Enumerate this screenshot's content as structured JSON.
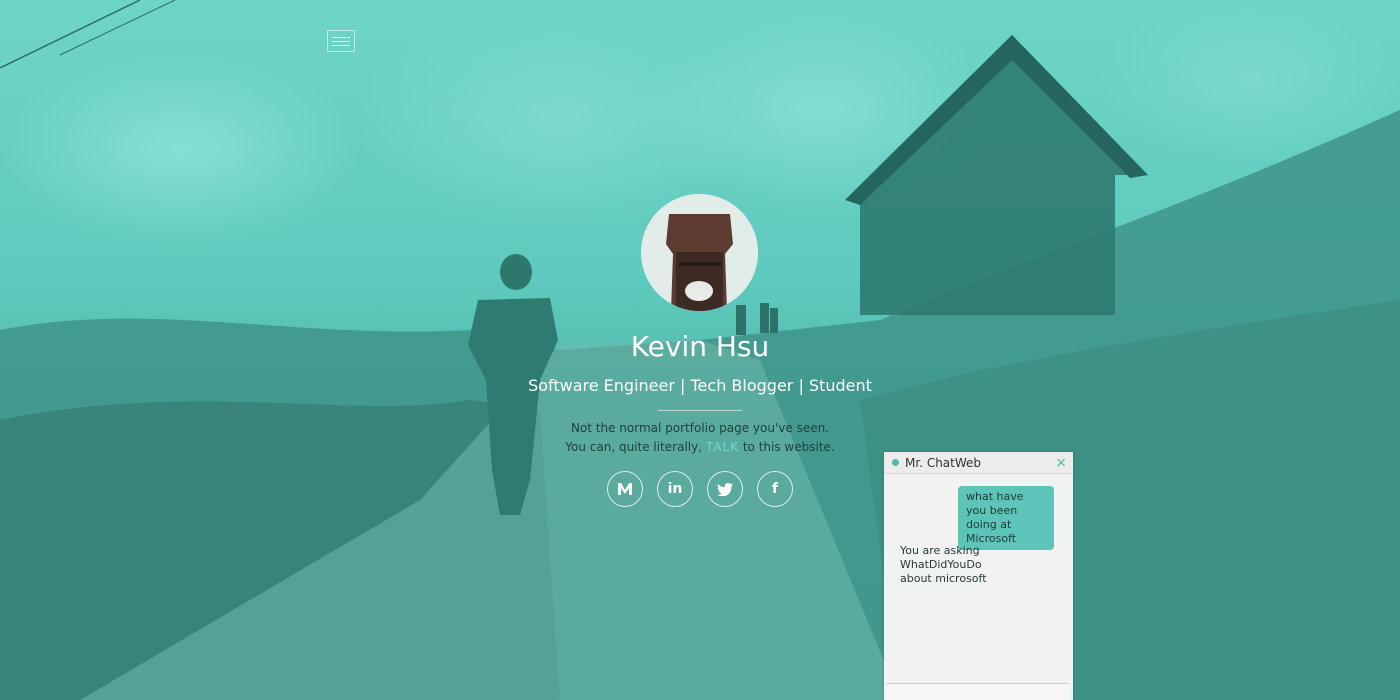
{
  "hero": {
    "name": "Kevin Hsu",
    "roles": "Software Engineer | Tech Blogger | Student",
    "tagline_line1": "Not the normal portfolio page you've seen.",
    "tagline_line2_prefix": "You can, quite literally, ",
    "tagline_highlight": "TALK",
    "tagline_line2_suffix": " to this website."
  },
  "socials": [
    {
      "name": "medium",
      "glyph": "M"
    },
    {
      "name": "linkedin",
      "glyph": "in"
    },
    {
      "name": "twitter",
      "glyph": "twitter-icon"
    },
    {
      "name": "facebook",
      "glyph": "f"
    }
  ],
  "chat": {
    "title": "Mr. ChatWeb",
    "close": "×",
    "user_message": "what have you been doing at Microsoft",
    "bot_message_lines": [
      "You are asking",
      "WhatDidYouDo",
      "about microsoft"
    ],
    "input_value": ""
  },
  "colors": {
    "accent": "#5cc4b8",
    "tagline_text": "#1f3f3b"
  }
}
